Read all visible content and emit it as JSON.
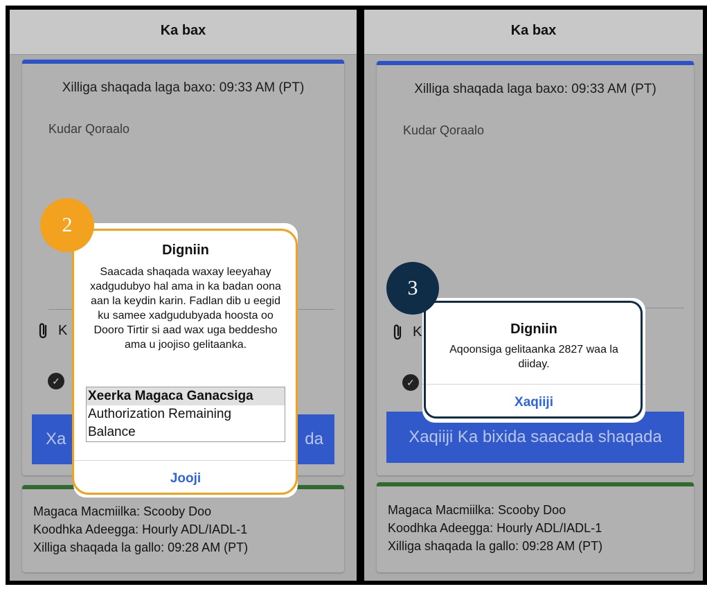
{
  "left": {
    "header_title": "Ka bax",
    "shift_end_time": "Xilliga shaqada laga baxo: 09:33 AM (PT)",
    "note_placeholder": "Kudar Qoraalo",
    "attach_label_partial": "K",
    "confirm_button_partial_left": "Xa",
    "confirm_button_partial_right": "da",
    "client_name": "Magaca Macmiilka: Scooby Doo",
    "service_code": "Koodhka Adeegga: Hourly ADL/IADL-1",
    "shift_start_time": "Xilliga shaqada la gallo: 09:28 AM (PT)",
    "callout_number": "2",
    "dialog": {
      "title": "Digniin",
      "message": "Saacada shaqada waxay leeyahay xadgudubyo hal ama in ka badan oona aan la keydin karin. Fadlan dib u eegid ku samee xadgudubyada hoosta oo Dooro Tirtir si aad wax uga beddesho ama u joojiso gelitaanka.",
      "violations": [
        "Xeerka Magaca Ganacsiga",
        "Authorization Remaining",
        "Balance"
      ],
      "button_label": "Jooji"
    }
  },
  "right": {
    "header_title": "Ka bax",
    "shift_end_time": "Xilliga shaqada laga baxo: 09:33 AM (PT)",
    "note_placeholder": "Kudar Qoraalo",
    "attach_label_partial": "K",
    "confirm_button_label": "Xaqiiji Ka bixida saacada shaqada",
    "client_name": "Magaca Macmiilka: Scooby Doo",
    "service_code": "Koodhka Adeegga: Hourly ADL/IADL-1",
    "shift_start_time": "Xilliga shaqada la gallo: 09:28 AM (PT)",
    "callout_number": "3",
    "dialog": {
      "title": "Digniin",
      "message": "Aqoonsiga gelitaanka 2827 waa la diiday.",
      "button_label": "Xaqiiji"
    }
  },
  "colors": {
    "accent_blue": "#2b52c6",
    "success_green": "#2f6a2f",
    "callout_orange": "#f2a21e",
    "callout_navy": "#0f2d47"
  }
}
